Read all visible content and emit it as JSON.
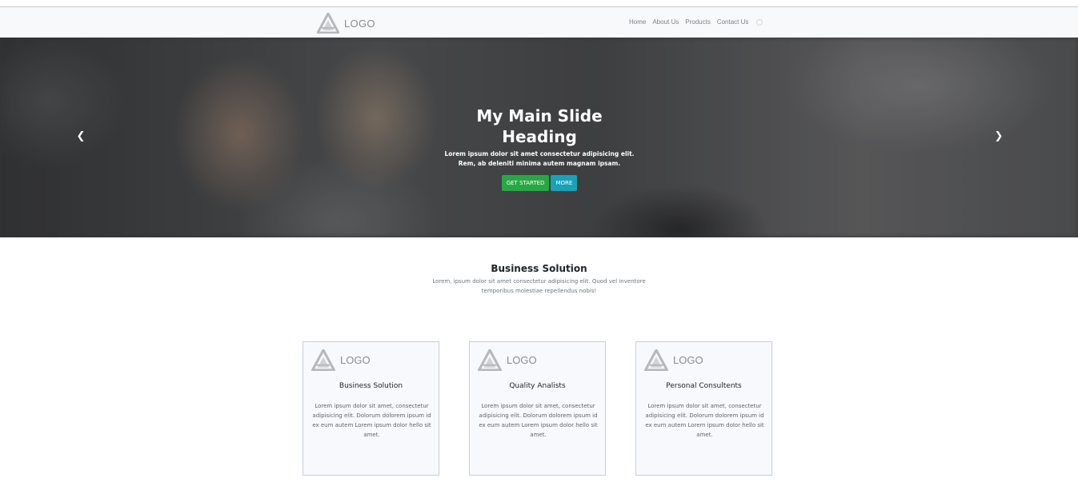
{
  "navbar": {
    "logo_text": "LOGO",
    "links": [
      "Home",
      "About Us",
      "Products",
      "Contact Us"
    ]
  },
  "hero": {
    "title": "My Main Slide Heading",
    "text": "Lorem ipsum dolor sit amet consectetur adipisicing elit. Rem, ab deleniti minima autem magnam ipsam.",
    "primary_button": "GET STARTED",
    "secondary_button": "MORE",
    "prev_icon": "chevron-left-icon",
    "next_icon": "chevron-right-icon"
  },
  "section": {
    "title": "Business Solution",
    "text": "Lorem, ipsum dolor sit amet consectetur adipisicing elit. Quod vel inventore temporibus molestiae repellendus nobis!"
  },
  "cards": [
    {
      "logo_text": "LOGO",
      "title": "Business Solution",
      "text": "Lorem ipsum dolor sit amet, consectetur adipisicing elit. Dolorum dolorem ipsum id ex eum autem Lorem ipsum dolor hello sit amet."
    },
    {
      "logo_text": "LOGO",
      "title": "Quality Analists",
      "text": "Lorem ipsum dolor sit amet, consectetur adipisicing elit. Dolorum dolorem ipsum id ex eum autem Lorem ipsum dolor hello sit amet."
    },
    {
      "logo_text": "LOGO",
      "title": "Personal Consultents",
      "text": "Lorem ipsum dolor sit amet, consectetur adipisicing elit. Dolorum dolorem ipsum id ex eum autem Lorem ipsum dolor hello sit amet."
    }
  ],
  "colors": {
    "primary_button": "#28a745",
    "secondary_button": "#17a2b8",
    "card_border": "#c5cde4",
    "navbar_bg": "#f8f9fa"
  }
}
